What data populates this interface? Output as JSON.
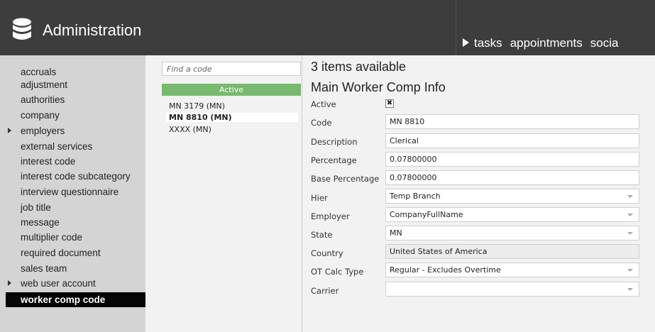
{
  "header": {
    "app_icon": "database-icon",
    "title": "Administration",
    "nav_icon": "play-icon",
    "nav_items": [
      "tasks",
      "appointments",
      "socia"
    ]
  },
  "sidebar": {
    "items": [
      {
        "label": "accruals",
        "expandable": false,
        "active": false
      },
      {
        "label": "adjustment",
        "expandable": false,
        "active": false
      },
      {
        "label": "authorities",
        "expandable": false,
        "active": false
      },
      {
        "label": "company",
        "expandable": false,
        "active": false
      },
      {
        "label": "employers",
        "expandable": true,
        "active": false
      },
      {
        "label": "external services",
        "expandable": false,
        "active": false
      },
      {
        "label": "interest code",
        "expandable": false,
        "active": false
      },
      {
        "label": "interest code subcategory",
        "expandable": false,
        "active": false
      },
      {
        "label": "interview questionnaire",
        "expandable": false,
        "active": false
      },
      {
        "label": "job title",
        "expandable": false,
        "active": false
      },
      {
        "label": "message",
        "expandable": false,
        "active": false
      },
      {
        "label": "multiplier code",
        "expandable": false,
        "active": false
      },
      {
        "label": "required document",
        "expandable": false,
        "active": false
      },
      {
        "label": "sales team",
        "expandable": false,
        "active": false
      },
      {
        "label": "web user account",
        "expandable": true,
        "active": false
      },
      {
        "label": "worker comp code",
        "expandable": false,
        "active": true
      }
    ]
  },
  "codes": {
    "search_placeholder": "Find a code",
    "status_filter": "Active",
    "status_color": "#77b96e",
    "items": [
      {
        "label": "MN 3179 (MN)",
        "selected": false
      },
      {
        "label": "MN 8810 (MN)",
        "selected": true
      },
      {
        "label": "XXXX (MN)",
        "selected": false
      }
    ]
  },
  "main": {
    "items_available": "3 items available",
    "section_title": "Main Worker Comp Info",
    "active": {
      "label": "Active",
      "checked": true,
      "mark": "✖"
    },
    "fields": [
      {
        "label": "Code",
        "value": "MN 8810",
        "type": "text"
      },
      {
        "label": "Description",
        "value": "Clerical",
        "type": "text"
      },
      {
        "label": "Percentage",
        "value": "0.07800000",
        "type": "text"
      },
      {
        "label": "Base Percentage",
        "value": "0.07800000",
        "type": "text"
      },
      {
        "label": "Hier",
        "value": "Temp Branch",
        "type": "select"
      },
      {
        "label": "Employer",
        "value": "CompanyFullName",
        "type": "select"
      },
      {
        "label": "State",
        "value": "MN",
        "type": "select"
      },
      {
        "label": "Country",
        "value": "United States of America",
        "type": "readonly"
      },
      {
        "label": "OT Calc Type",
        "value": "Regular - Excludes Overtime",
        "type": "select"
      },
      {
        "label": "Carrier",
        "value": "",
        "type": "select"
      }
    ]
  }
}
